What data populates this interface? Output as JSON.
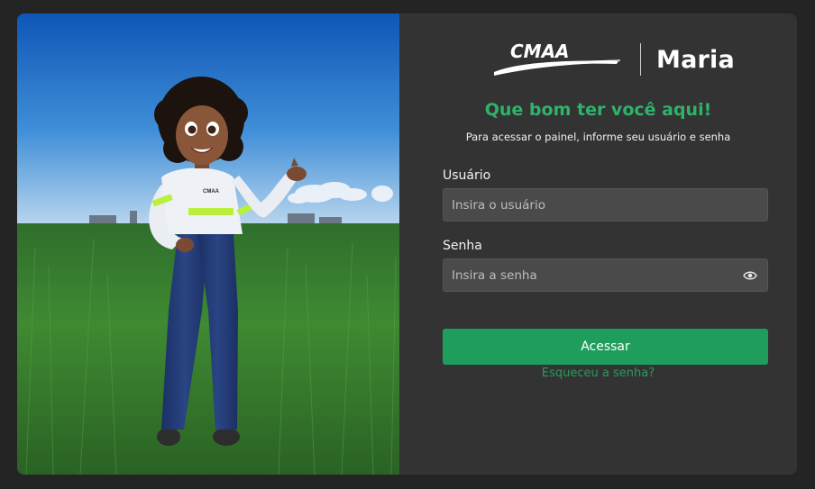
{
  "brand": {
    "logo_text": "CMAA",
    "product_name": "Maria",
    "shirt_logo_text": "CMAA"
  },
  "login": {
    "welcome_title": "Que bom ter você aqui!",
    "subtitle": "Para acessar o painel, informe seu usuário e senha",
    "username_label": "Usuário",
    "username_placeholder": "Insira o usuário",
    "username_value": "",
    "password_label": "Senha",
    "password_placeholder": "Insira a senha",
    "password_value": "",
    "password_toggle_icon": "eye-icon",
    "submit_label": "Acessar",
    "forgot_password_label": "Esqueceu a senha?"
  },
  "colors": {
    "accent_green": "#1f9d5c",
    "title_green": "#2fb36a",
    "panel_bg": "#333333",
    "page_bg": "#242424",
    "field_bg": "#4a4a4a"
  }
}
